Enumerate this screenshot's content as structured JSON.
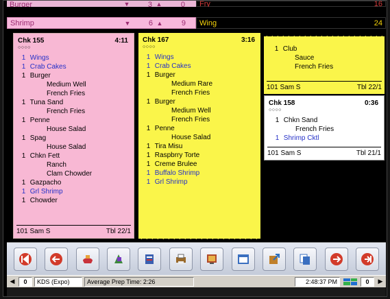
{
  "summary": {
    "row1": {
      "item": "Burger",
      "qty_a": "3",
      "qty_b": "0",
      "right_label": "Fry",
      "right_count": "16"
    },
    "row2": {
      "item": "Shrimp",
      "qty_a": "6",
      "qty_b": "9",
      "right_label": "Wing",
      "right_count": "24"
    }
  },
  "tickets": {
    "chk155": {
      "check": "Chk 155",
      "elapsed": "4:11",
      "dots": "○○○○",
      "items": [
        {
          "qty": "1",
          "name": "Wings",
          "blue": true
        },
        {
          "qty": "1",
          "name": "Crab Cakes",
          "blue": true
        },
        {
          "qty": "1",
          "name": "Burger"
        },
        {
          "mod": "Medium Well"
        },
        {
          "mod": "French Fries"
        },
        {
          "qty": "1",
          "name": "Tuna Sand"
        },
        {
          "mod": "French Fries"
        },
        {
          "qty": "1",
          "name": "Penne"
        },
        {
          "mod": "House Salad"
        },
        {
          "qty": "1",
          "name": "Spag"
        },
        {
          "mod": "House Salad"
        },
        {
          "qty": "1",
          "name": "Chkn Fett"
        },
        {
          "mod": "Ranch"
        },
        {
          "mod": "Clam Chowder"
        },
        {
          "qty": "1",
          "name": "Gazpacho"
        },
        {
          "qty": "1",
          "name": "Grl Shrimp",
          "blue": true
        },
        {
          "qty": "1",
          "name": "Chowder"
        }
      ],
      "server": "101 Sam S",
      "table": "Tbl 22/1"
    },
    "chk167": {
      "check": "Chk 167",
      "elapsed": "3:16",
      "dots": "○○○○",
      "items": [
        {
          "qty": "1",
          "name": "Wings",
          "blue": true
        },
        {
          "qty": "1",
          "name": "Crab Cakes",
          "blue": true
        },
        {
          "qty": "1",
          "name": "Burger"
        },
        {
          "mod": "Medium Rare"
        },
        {
          "mod": "French Fries"
        },
        {
          "qty": "1",
          "name": "Burger"
        },
        {
          "mod": "Medium Well"
        },
        {
          "mod": "French Fries"
        },
        {
          "qty": "1",
          "name": "Penne"
        },
        {
          "mod": "House Salad"
        },
        {
          "qty": "1",
          "name": "Tira Misu"
        },
        {
          "qty": "1",
          "name": "Raspbrry Torte"
        },
        {
          "qty": "1",
          "name": "Creme Brulee"
        },
        {
          "qty": "1",
          "name": "Buffalo Shrimp",
          "blue": true
        },
        {
          "qty": "1",
          "name": "Grl Shrimp",
          "blue": true
        }
      ]
    },
    "club": {
      "items": [
        {
          "qty": "1",
          "name": "Club"
        },
        {
          "mod": "Sauce"
        },
        {
          "mod": "French Fries"
        }
      ],
      "server": "101 Sam S",
      "table": "Tbl 22/1"
    },
    "chk158": {
      "check": "Chk 158",
      "elapsed": "0:36",
      "dots": "○○○○",
      "items": [
        {
          "qty": "1",
          "name": "Chkn Sand"
        },
        {
          "mod": "French Fries"
        },
        {
          "qty": "1",
          "name": "Shrimp Cktl",
          "blue": true
        }
      ],
      "server": "101 Sam S",
      "table": "Tbl 21/1"
    }
  },
  "toolbar": {
    "buttons": [
      {
        "name": "first-page-button",
        "icon": "first-page-icon",
        "color": "#d23b2a"
      },
      {
        "name": "previous-button",
        "icon": "back-arrow-icon",
        "color": "#d23b2a"
      },
      {
        "name": "bump-button",
        "icon": "bump-icon",
        "color": "#c8323a"
      },
      {
        "name": "recall-button",
        "icon": "recall-icon",
        "color": "#3c8a3c"
      },
      {
        "name": "summary-button",
        "icon": "summary-icon",
        "color": "#3a5fb0"
      },
      {
        "name": "printer-button",
        "icon": "printer-icon",
        "color": "#9a6a2a"
      },
      {
        "name": "display-button",
        "icon": "display-icon",
        "color": "#b04a2a"
      },
      {
        "name": "window-button",
        "icon": "window-icon",
        "color": "#3a6fc0"
      },
      {
        "name": "export-button",
        "icon": "export-icon",
        "color": "#c0802a"
      },
      {
        "name": "copy-button",
        "icon": "copy-icon",
        "color": "#3a6fc0"
      },
      {
        "name": "next-button",
        "icon": "forward-arrow-icon",
        "color": "#d23b2a"
      },
      {
        "name": "exit-button",
        "icon": "exit-icon",
        "color": "#d23b2a"
      }
    ]
  },
  "status": {
    "left_num": "0",
    "station": "KDS (Expo)",
    "prep": "Average Prep Time: 2:26",
    "time": "2:48:37 PM",
    "right_num": "0"
  },
  "colors": {
    "pink_ticket": "#f8b8d4",
    "yellow_ticket": "#faf54a",
    "blue_item": "#2430c8",
    "summary_text": "#f7d40a"
  }
}
